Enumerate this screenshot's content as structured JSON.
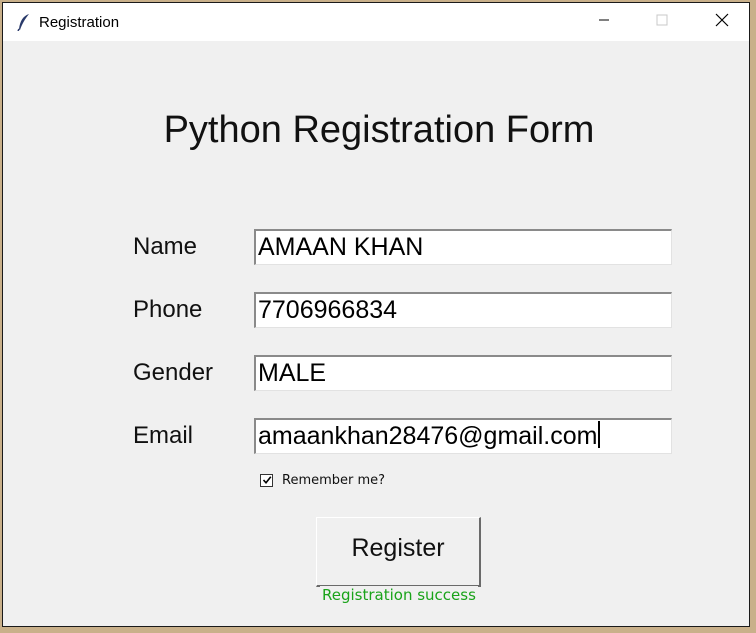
{
  "window": {
    "title": "Registration",
    "controls": {
      "minimize_icon": "minimize-icon",
      "maximize_icon": "maximize-icon",
      "close_icon": "close-icon"
    }
  },
  "form": {
    "heading": "Python Registration Form",
    "fields": [
      {
        "label": "Name",
        "value": "AMAAN KHAN"
      },
      {
        "label": "Phone",
        "value": "7706966834"
      },
      {
        "label": "Gender",
        "value": "MALE"
      },
      {
        "label": "Email",
        "value": "amaankhan28476@gmail.com"
      }
    ],
    "remember": {
      "label": "Remember me?",
      "checked": true
    },
    "submit_label": "Register",
    "status_message": "Registration success"
  },
  "colors": {
    "status_text": "#1aa31a",
    "window_bg": "#f0f0f0",
    "desktop_bg": "#c9b08a"
  }
}
